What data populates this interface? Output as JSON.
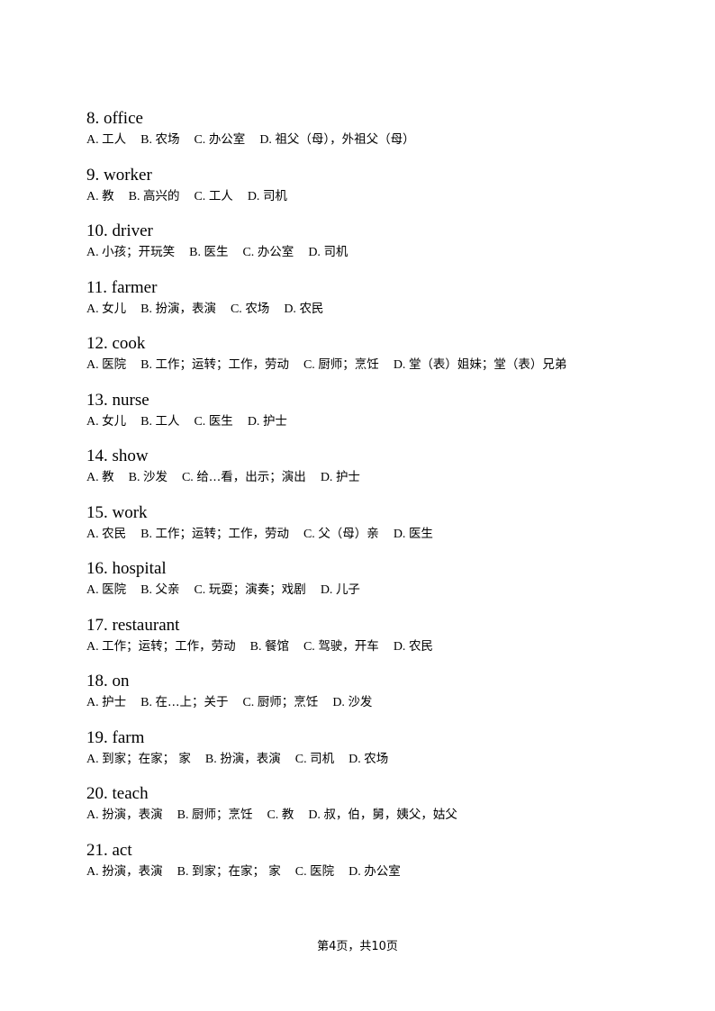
{
  "questions": [
    {
      "number": "8.",
      "word": "office",
      "options": [
        {
          "letter": "A.",
          "text": "工人"
        },
        {
          "letter": "B.",
          "text": "农场"
        },
        {
          "letter": "C.",
          "text": "办公室"
        },
        {
          "letter": "D.",
          "text": "祖父（母），外祖父（母）"
        }
      ]
    },
    {
      "number": "9.",
      "word": "worker",
      "options": [
        {
          "letter": "A.",
          "text": "教"
        },
        {
          "letter": "B.",
          "text": "高兴的"
        },
        {
          "letter": "C.",
          "text": "工人"
        },
        {
          "letter": "D.",
          "text": "司机"
        }
      ]
    },
    {
      "number": "10.",
      "word": "driver",
      "options": [
        {
          "letter": "A.",
          "text": "小孩；开玩笑"
        },
        {
          "letter": "B.",
          "text": "医生"
        },
        {
          "letter": "C.",
          "text": "办公室"
        },
        {
          "letter": "D.",
          "text": "司机"
        }
      ]
    },
    {
      "number": "11.",
      "word": "farmer",
      "options": [
        {
          "letter": "A.",
          "text": "女儿"
        },
        {
          "letter": "B.",
          "text": "扮演，表演"
        },
        {
          "letter": "C.",
          "text": "农场"
        },
        {
          "letter": "D.",
          "text": "农民"
        }
      ]
    },
    {
      "number": "12.",
      "word": "cook",
      "options": [
        {
          "letter": "A.",
          "text": "医院"
        },
        {
          "letter": "B.",
          "text": "工作；运转；工作，劳动"
        },
        {
          "letter": "C.",
          "text": "厨师；烹饪"
        },
        {
          "letter": "D.",
          "text": "堂（表）姐妹；堂（表）兄弟"
        }
      ]
    },
    {
      "number": "13.",
      "word": "nurse",
      "options": [
        {
          "letter": "A.",
          "text": "女儿"
        },
        {
          "letter": "B.",
          "text": "工人"
        },
        {
          "letter": "C.",
          "text": "医生"
        },
        {
          "letter": "D.",
          "text": "护士"
        }
      ]
    },
    {
      "number": "14.",
      "word": "show",
      "options": [
        {
          "letter": "A.",
          "text": "教"
        },
        {
          "letter": "B.",
          "text": "沙发"
        },
        {
          "letter": "C.",
          "text": "给…看，出示；演出"
        },
        {
          "letter": "D.",
          "text": "护士"
        }
      ]
    },
    {
      "number": "15.",
      "word": "work",
      "options": [
        {
          "letter": "A.",
          "text": "农民"
        },
        {
          "letter": "B.",
          "text": "工作；运转；工作，劳动"
        },
        {
          "letter": "C.",
          "text": "父（母）亲"
        },
        {
          "letter": "D.",
          "text": "医生"
        }
      ]
    },
    {
      "number": "16.",
      "word": "hospital",
      "options": [
        {
          "letter": "A.",
          "text": "医院"
        },
        {
          "letter": "B.",
          "text": "父亲"
        },
        {
          "letter": "C.",
          "text": "玩耍；演奏；戏剧"
        },
        {
          "letter": "D.",
          "text": "儿子"
        }
      ]
    },
    {
      "number": "17.",
      "word": "restaurant",
      "options": [
        {
          "letter": "A.",
          "text": "工作；运转；工作，劳动"
        },
        {
          "letter": "B.",
          "text": "餐馆"
        },
        {
          "letter": "C.",
          "text": "驾驶，开车"
        },
        {
          "letter": "D.",
          "text": "农民"
        }
      ]
    },
    {
      "number": "18.",
      "word": "on",
      "options": [
        {
          "letter": "A.",
          "text": "护士"
        },
        {
          "letter": "B.",
          "text": "在…上；关于"
        },
        {
          "letter": "C.",
          "text": "厨师；烹饪"
        },
        {
          "letter": "D.",
          "text": "沙发"
        }
      ]
    },
    {
      "number": "19.",
      "word": "farm",
      "options": [
        {
          "letter": "A.",
          "text": "到家；在家； 家"
        },
        {
          "letter": "B.",
          "text": "扮演，表演"
        },
        {
          "letter": "C.",
          "text": "司机"
        },
        {
          "letter": "D.",
          "text": "农场"
        }
      ]
    },
    {
      "number": "20.",
      "word": "teach",
      "options": [
        {
          "letter": "A.",
          "text": "扮演，表演"
        },
        {
          "letter": "B.",
          "text": "厨师；烹饪"
        },
        {
          "letter": "C.",
          "text": "教"
        },
        {
          "letter": "D.",
          "text": "叔，伯，舅，姨父，姑父"
        }
      ]
    },
    {
      "number": "21.",
      "word": "act",
      "options": [
        {
          "letter": "A.",
          "text": "扮演，表演"
        },
        {
          "letter": "B.",
          "text": "到家；在家； 家"
        },
        {
          "letter": "C.",
          "text": "医院"
        },
        {
          "letter": "D.",
          "text": "办公室"
        }
      ]
    }
  ],
  "footer": {
    "page_label": "第4页，共10页"
  }
}
